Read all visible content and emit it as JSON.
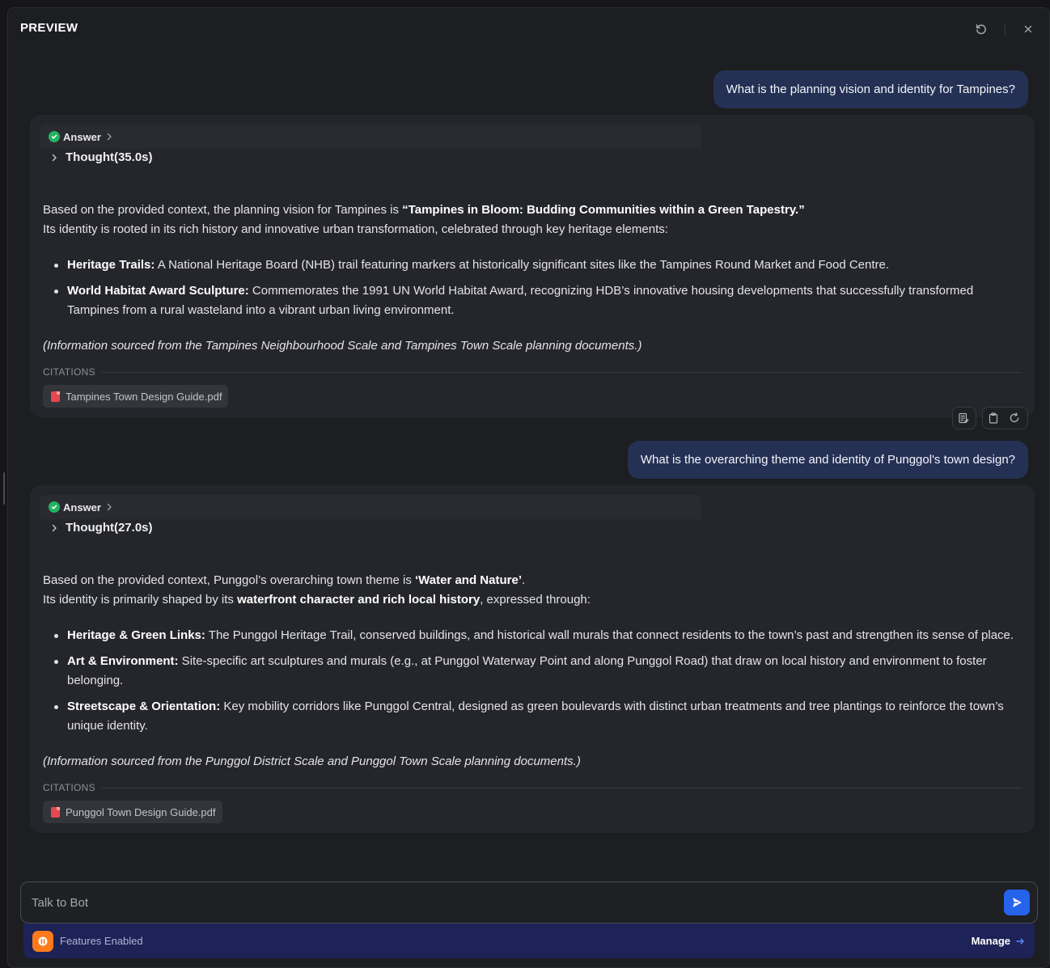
{
  "header": {
    "title": "PREVIEW"
  },
  "colors": {
    "accent": "#2563eb",
    "user_bubble": "#243154",
    "success": "#22b35e",
    "features_bar": "#1d2257",
    "features_icon": "#ff7a1a",
    "pdf": "#e5484d"
  },
  "icons": {
    "refresh": "refresh-icon",
    "close": "close-icon",
    "send": "send-icon",
    "pdf": "pdf-file-icon",
    "manage": "arrow-right-icon"
  },
  "conversation": [
    {
      "question": "What is the planning vision and identity for Tampines?",
      "answer": {
        "status_label": "Answer",
        "thought_label": "Thought(35.0s)",
        "intro_prefix": "Based on the provided context, the planning vision for Tampines is ",
        "intro_bold": "“Tampines in Bloom: Budding Communities within a Green Tapestry.”",
        "intro_line2": "Its identity is rooted in its rich history and innovative urban transformation, celebrated through key heritage elements:",
        "bullets": [
          {
            "title": "Heritage Trails:",
            "text": " A National Heritage Board (NHB) trail featuring markers at historically significant sites like the Tampines Round Market and Food Centre."
          },
          {
            "title": "World Habitat Award Sculpture:",
            "text": " Commemorates the 1991 UN World Habitat Award, recognizing HDB’s innovative housing developments that successfully transformed Tampines from a rural wasteland into a vibrant urban living environment."
          }
        ],
        "source_note": "(Information sourced from the Tampines Neighbourhood Scale and Tampines Town Scale planning documents.)",
        "citations_label": "CITATIONS",
        "citation_file": "Tampines Town Design Guide.pdf"
      }
    },
    {
      "question": "What is the overarching theme and identity of Punggol's town design?",
      "answer": {
        "status_label": "Answer",
        "thought_label": "Thought(27.0s)",
        "intro_prefix": "Based on the provided context, Punggol’s overarching town theme is ",
        "intro_bold": "‘Water and Nature’",
        "intro_suffix": ".",
        "intro_line2_prefix": "Its identity is primarily shaped by its ",
        "intro_line2_bold": "waterfront character and rich local history",
        "intro_line2_suffix": ", expressed through:",
        "bullets": [
          {
            "title": "Heritage & Green Links:",
            "text": " The Punggol Heritage Trail, conserved buildings, and historical wall murals that connect residents to the town’s past and strengthen its sense of place."
          },
          {
            "title": "Art & Environment:",
            "text": " Site-specific art sculptures and murals (e.g., at Punggol Waterway Point and along Punggol Road) that draw on local history and environment to foster belonging."
          },
          {
            "title": "Streetscape & Orientation:",
            "text": " Key mobility corridors like Punggol Central, designed as green boulevards with distinct urban treatments and tree plantings to reinforce the town’s unique identity."
          }
        ],
        "source_note": "(Information sourced from the Punggol District Scale and Punggol Town Scale planning documents.)",
        "citations_label": "CITATIONS",
        "citation_file": "Punggol Town Design Guide.pdf"
      }
    }
  ],
  "composer": {
    "placeholder": "Talk to Bot"
  },
  "features": {
    "label": "Features Enabled",
    "manage_label": "Manage"
  }
}
